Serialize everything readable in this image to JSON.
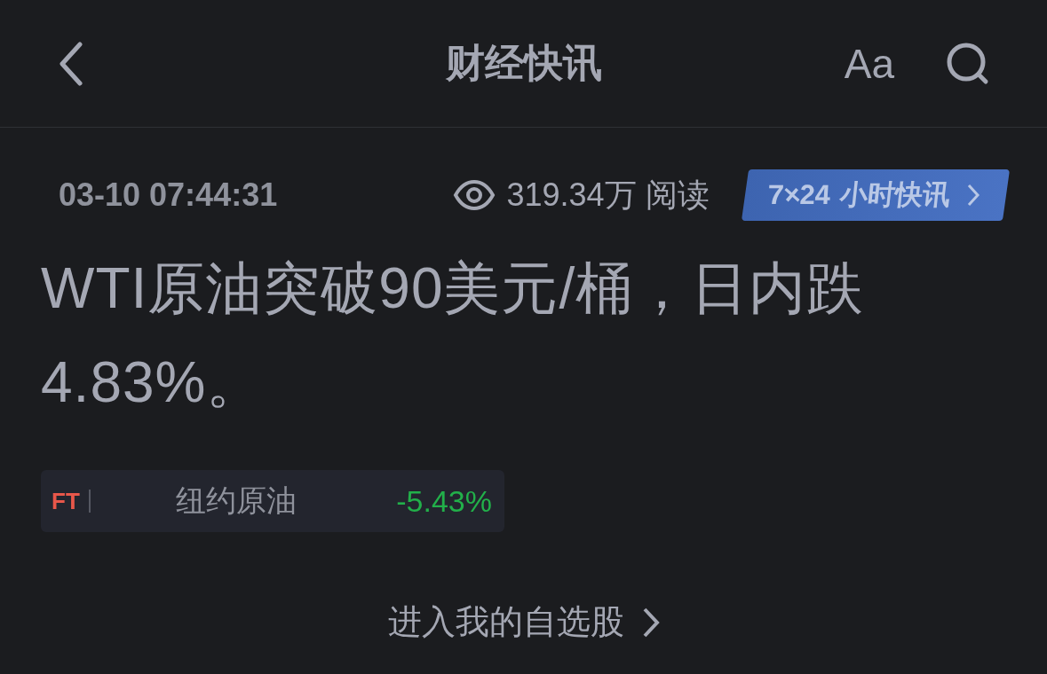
{
  "header": {
    "title": "财经快讯",
    "font_button": "Aa"
  },
  "news": {
    "time": "03-10 07:44:31",
    "reads": "319.34万 阅读",
    "channel": "7×24 小时快讯",
    "headline": "WTI原油突破90美元/桶，日内跌4.83%。"
  },
  "stock": {
    "source": "FT",
    "name": "纽约原油",
    "change": "-5.43%"
  },
  "watchlist_link": "进入我的自选股"
}
